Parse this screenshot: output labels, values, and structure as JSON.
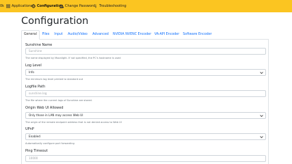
{
  "nav": {
    "items": [
      {
        "label": "Applications",
        "icon": "list-icon"
      },
      {
        "label": "Configuration",
        "icon": "gear-icon",
        "active": true
      },
      {
        "label": "Change Password",
        "icon": "user-lock-icon"
      },
      {
        "label": "Troubleshooting",
        "icon": "info-icon"
      }
    ]
  },
  "page": {
    "title": "Configuration"
  },
  "tabs": [
    "General",
    "Files",
    "Input",
    "Audio/Video",
    "Advanced",
    "NVIDIA NVENC Encoder",
    "VA-API Encoder",
    "Software Encoder"
  ],
  "fields": {
    "sunshine_name": {
      "label": "Sunshine Name",
      "placeholder": "Sunshine",
      "help": "The name displayed by Moonlight. If not specified, the PC's hostname is used"
    },
    "log_level": {
      "label": "Log Level",
      "value": "Info",
      "help": "The minimum log level printed to standard out"
    },
    "logfile_path": {
      "label": "Logfile Path",
      "placeholder": "sunshine.log",
      "help": "The file where the current logs of Sunshine are stored."
    },
    "origin_web_ui": {
      "label": "Origin Web UI Allowed",
      "value": "Only those in LAN may access Web UI",
      "help": "The origin of the remote endpoint address that is not denied access to Web UI"
    },
    "upnp": {
      "label": "UPnP",
      "value": "Enabled",
      "help": "Automatically configure port forwarding"
    },
    "ping_timeout": {
      "label": "Ping Timeout",
      "placeholder": "10000"
    }
  },
  "colors": {
    "navbar": "#fbc521",
    "link": "#0d6efd"
  }
}
